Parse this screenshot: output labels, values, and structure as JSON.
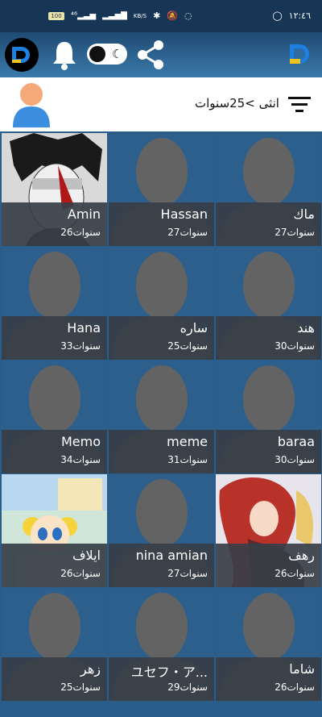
{
  "status": {
    "time": "١٢:٤٦",
    "battery": "100",
    "net_speed": "KB/S",
    "colors": {
      "bar": "#173656"
    }
  },
  "header": {
    "icons": [
      "app-logo-icon",
      "bell-icon",
      "night-mode-toggle",
      "share-icon",
      "brand-logo-icon"
    ]
  },
  "filter": {
    "text": "انثى >25سنوات",
    "icon": "filter-lines-icon"
  },
  "profiles": [
    {
      "name": "ماك",
      "age": "27سنوات",
      "photo": "silhouette"
    },
    {
      "name": "Hassan",
      "age": "27سنوات",
      "photo": "silhouette"
    },
    {
      "name": "Amin",
      "age": "26سنوات",
      "photo": "manga-portrait"
    },
    {
      "name": "هند",
      "age": "30سنوات",
      "photo": "silhouette"
    },
    {
      "name": "ساره",
      "age": "25سنوات",
      "photo": "silhouette"
    },
    {
      "name": "Hana",
      "age": "33سنوات",
      "photo": "silhouette"
    },
    {
      "name": "baraa",
      "age": "30سنوات",
      "photo": "silhouette"
    },
    {
      "name": "meme",
      "age": "31سنوات",
      "photo": "silhouette"
    },
    {
      "name": "Memo",
      "age": "34سنوات",
      "photo": "silhouette"
    },
    {
      "name": "رهف",
      "age": "26سنوات",
      "photo": "anime-red-hair"
    },
    {
      "name": "nina amian",
      "age": "27سنوات",
      "photo": "silhouette"
    },
    {
      "name": "ايلاف",
      "age": "26سنوات",
      "photo": "cartoon"
    },
    {
      "name": "شاما",
      "age": "26سنوات",
      "photo": "silhouette"
    },
    {
      "name": "ユセフ・ア...",
      "age": "29سنوات",
      "photo": "silhouette"
    },
    {
      "name": "زهر",
      "age": "25سنوات",
      "photo": "silhouette"
    }
  ]
}
